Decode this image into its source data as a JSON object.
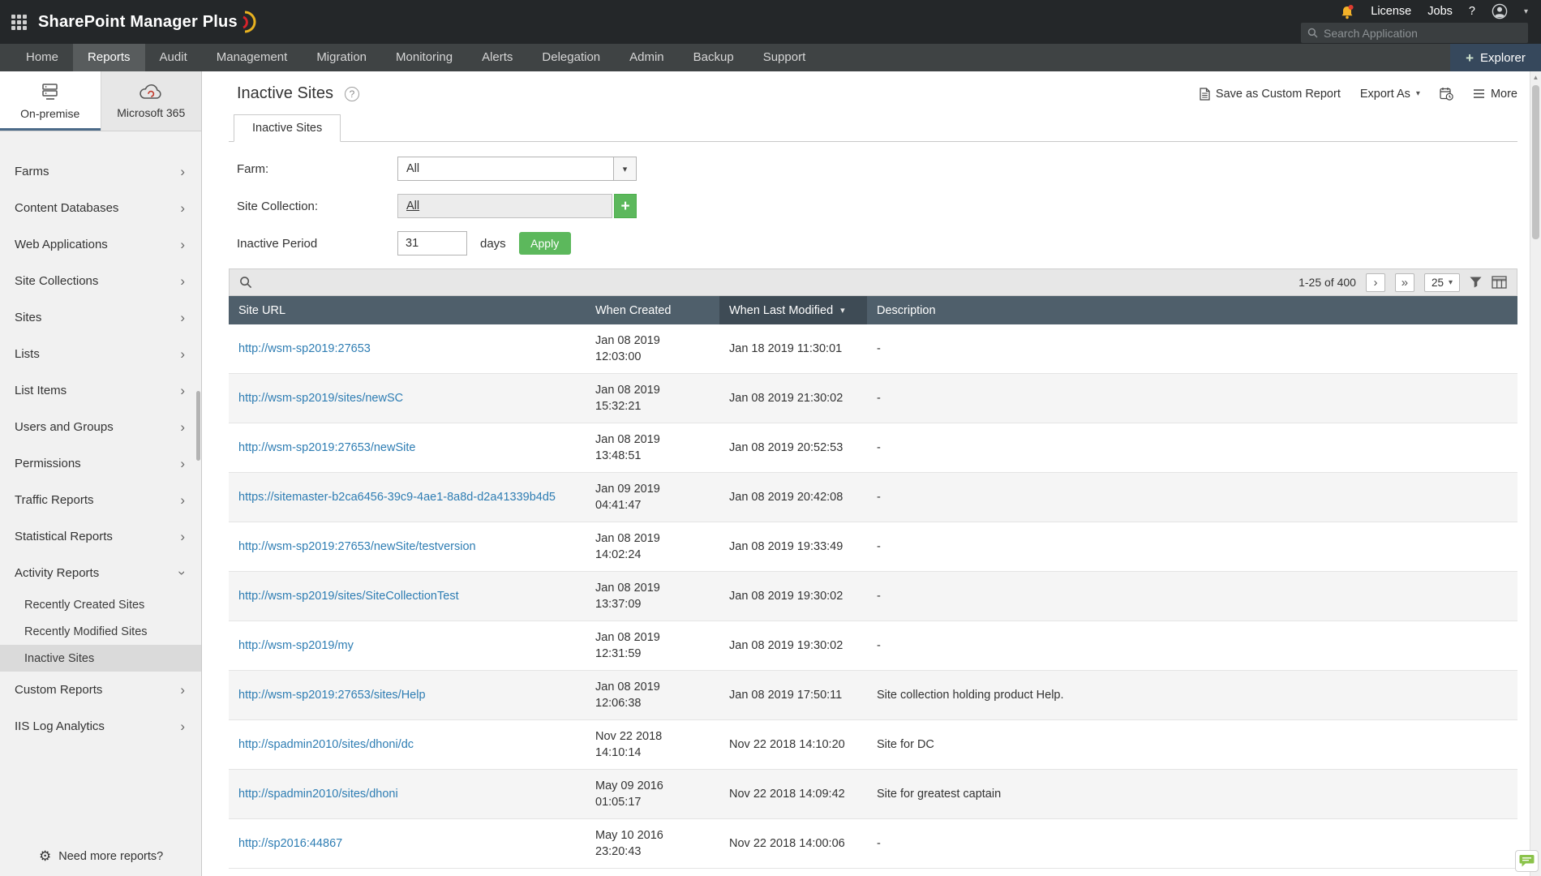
{
  "header": {
    "app_title": "SharePoint Manager Plus",
    "search_placeholder": "Search Application",
    "license_label": "License",
    "jobs_label": "Jobs",
    "help_label": "?"
  },
  "nav": {
    "tabs": [
      "Home",
      "Reports",
      "Audit",
      "Management",
      "Migration",
      "Monitoring",
      "Alerts",
      "Delegation",
      "Admin",
      "Backup",
      "Support"
    ],
    "active_tab": "Reports",
    "explorer_label": "Explorer"
  },
  "sidebar": {
    "tabs": [
      {
        "label": "On-premise",
        "active": true
      },
      {
        "label": "Microsoft 365",
        "active": false
      }
    ],
    "items": [
      {
        "label": "Farms",
        "type": "main"
      },
      {
        "label": "Content Databases",
        "type": "main"
      },
      {
        "label": "Web Applications",
        "type": "main"
      },
      {
        "label": "Site Collections",
        "type": "main"
      },
      {
        "label": "Sites",
        "type": "main"
      },
      {
        "label": "Lists",
        "type": "main"
      },
      {
        "label": "List Items",
        "type": "main"
      },
      {
        "label": "Users and Groups",
        "type": "main"
      },
      {
        "label": "Permissions",
        "type": "main"
      },
      {
        "label": "Traffic Reports",
        "type": "main"
      },
      {
        "label": "Statistical Reports",
        "type": "main"
      },
      {
        "label": "Activity Reports",
        "type": "main",
        "expanded": true
      },
      {
        "label": "Recently Created Sites",
        "type": "sub"
      },
      {
        "label": "Recently Modified Sites",
        "type": "sub"
      },
      {
        "label": "Inactive Sites",
        "type": "sub",
        "selected": true
      },
      {
        "label": "Custom Reports",
        "type": "main"
      },
      {
        "label": "IIS Log Analytics",
        "type": "main"
      }
    ],
    "footer_label": "Need more reports?"
  },
  "content": {
    "page_title": "Inactive Sites",
    "toolbar": {
      "save_label": "Save as Custom Report",
      "export_label": "Export As",
      "more_label": "More"
    },
    "tab_label": "Inactive Sites",
    "filters": {
      "farm_label": "Farm:",
      "farm_value": "All",
      "site_collection_label": "Site Collection:",
      "site_collection_value": "All",
      "inactive_period_label": "Inactive Period",
      "inactive_period_value": "31",
      "days_label": "days",
      "apply_label": "Apply"
    },
    "pagination": {
      "range_text": "1-25 of 400",
      "page_size": "25"
    },
    "table": {
      "columns": [
        "Site URL",
        "When Created",
        "When Last Modified",
        "Description"
      ],
      "sort_column": "When Last Modified",
      "sort_direction": "desc",
      "rows": [
        {
          "url": "http://wsm-sp2019:27653",
          "created_date": "Jan 08 2019",
          "created_time": "12:03:00",
          "modified": "Jan 18 2019 11:30:01",
          "description": "-"
        },
        {
          "url": "http://wsm-sp2019/sites/newSC",
          "created_date": "Jan 08 2019",
          "created_time": "15:32:21",
          "modified": "Jan 08 2019 21:30:02",
          "description": "-"
        },
        {
          "url": "http://wsm-sp2019:27653/newSite",
          "created_date": "Jan 08 2019",
          "created_time": "13:48:51",
          "modified": "Jan 08 2019 20:52:53",
          "description": "-"
        },
        {
          "url": "https://sitemaster-b2ca6456-39c9-4ae1-8a8d-d2a41339b4d5",
          "created_date": "Jan 09 2019",
          "created_time": "04:41:47",
          "modified": "Jan 08 2019 20:42:08",
          "description": "-"
        },
        {
          "url": "http://wsm-sp2019:27653/newSite/testversion",
          "created_date": "Jan 08 2019",
          "created_time": "14:02:24",
          "modified": "Jan 08 2019 19:33:49",
          "description": "-"
        },
        {
          "url": "http://wsm-sp2019/sites/SiteCollectionTest",
          "created_date": "Jan 08 2019",
          "created_time": "13:37:09",
          "modified": "Jan 08 2019 19:30:02",
          "description": "-"
        },
        {
          "url": "http://wsm-sp2019/my",
          "created_date": "Jan 08 2019",
          "created_time": "12:31:59",
          "modified": "Jan 08 2019 19:30:02",
          "description": "-"
        },
        {
          "url": "http://wsm-sp2019:27653/sites/Help",
          "created_date": "Jan 08 2019",
          "created_time": "12:06:38",
          "modified": "Jan 08 2019 17:50:11",
          "description": "Site collection holding product Help."
        },
        {
          "url": "http://spadmin2010/sites/dhoni/dc",
          "created_date": "Nov 22 2018",
          "created_time": "14:10:14",
          "modified": "Nov 22 2018 14:10:20",
          "description": "Site for DC"
        },
        {
          "url": "http://spadmin2010/sites/dhoni",
          "created_date": "May 09 2016",
          "created_time": "01:05:17",
          "modified": "Nov 22 2018 14:09:42",
          "description": "Site for greatest captain"
        },
        {
          "url": "http://sp2016:44867",
          "created_date": "May 10 2016",
          "created_time": "23:20:43",
          "modified": "Nov 22 2018 14:00:06",
          "description": "-"
        }
      ]
    }
  },
  "icons": {
    "chevron_right": "›",
    "sort_desc": "▾",
    "caret_down": "▾",
    "next_page": "›",
    "last_page": "»",
    "add": "+",
    "help": "?",
    "user_caret": "▾",
    "gear": "⚙",
    "scroll_up": "▲",
    "scroll_down": "▼"
  },
  "colors": {
    "accent_green": "#5cb85c",
    "table_header": "#4f5f6b",
    "table_header_sorted": "#3e4b55",
    "link_blue": "#2e7db3",
    "topbar": "#242729",
    "nav": "#3f4344"
  }
}
